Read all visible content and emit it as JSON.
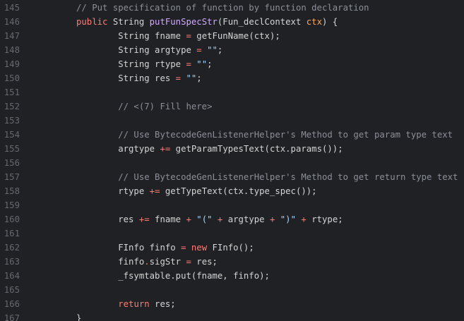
{
  "editor": {
    "lines": [
      {
        "n": "145",
        "tokens": [
          {
            "t": "// Put specification of function by function declaration",
            "c": "comment"
          }
        ]
      },
      {
        "n": "146",
        "tokens": [
          {
            "t": "public",
            "c": "kw"
          },
          {
            "t": " String ",
            "c": "plain"
          },
          {
            "t": "putFunSpecStr",
            "c": "fn"
          },
          {
            "t": "(Fun_declContext ",
            "c": "plain"
          },
          {
            "t": "ctx",
            "c": "param"
          },
          {
            "t": ") {",
            "c": "plain"
          }
        ]
      },
      {
        "n": "147",
        "tokens": [
          {
            "t": "        String fname ",
            "c": "plain"
          },
          {
            "t": "=",
            "c": "op"
          },
          {
            "t": " getFunName(ctx);",
            "c": "plain"
          }
        ]
      },
      {
        "n": "148",
        "tokens": [
          {
            "t": "        String argtype ",
            "c": "plain"
          },
          {
            "t": "=",
            "c": "op"
          },
          {
            "t": " ",
            "c": "plain"
          },
          {
            "t": "\"\"",
            "c": "str"
          },
          {
            "t": ";",
            "c": "plain"
          }
        ]
      },
      {
        "n": "149",
        "tokens": [
          {
            "t": "        String rtype ",
            "c": "plain"
          },
          {
            "t": "=",
            "c": "op"
          },
          {
            "t": " ",
            "c": "plain"
          },
          {
            "t": "\"\"",
            "c": "str"
          },
          {
            "t": ";",
            "c": "plain"
          }
        ]
      },
      {
        "n": "150",
        "tokens": [
          {
            "t": "        String res ",
            "c": "plain"
          },
          {
            "t": "=",
            "c": "op"
          },
          {
            "t": " ",
            "c": "plain"
          },
          {
            "t": "\"\"",
            "c": "str"
          },
          {
            "t": ";",
            "c": "plain"
          }
        ]
      },
      {
        "n": "151",
        "tokens": []
      },
      {
        "n": "152",
        "tokens": [
          {
            "t": "        // <(7) Fill here>",
            "c": "comment"
          }
        ]
      },
      {
        "n": "153",
        "tokens": []
      },
      {
        "n": "154",
        "tokens": [
          {
            "t": "        // Use BytecodeGenListenerHelper's Method to get param type text",
            "c": "comment"
          }
        ]
      },
      {
        "n": "155",
        "tokens": [
          {
            "t": "        argtype ",
            "c": "plain"
          },
          {
            "t": "+=",
            "c": "op"
          },
          {
            "t": " getParamTypesText(ctx.params());",
            "c": "plain"
          }
        ]
      },
      {
        "n": "156",
        "tokens": []
      },
      {
        "n": "157",
        "tokens": [
          {
            "t": "        // Use BytecodeGenListenerHelper's Method to get return type text",
            "c": "comment"
          }
        ]
      },
      {
        "n": "158",
        "tokens": [
          {
            "t": "        rtype ",
            "c": "plain"
          },
          {
            "t": "+=",
            "c": "op"
          },
          {
            "t": " getTypeText(ctx.type_spec());",
            "c": "plain"
          }
        ]
      },
      {
        "n": "159",
        "tokens": []
      },
      {
        "n": "160",
        "tokens": [
          {
            "t": "        res ",
            "c": "plain"
          },
          {
            "t": "+=",
            "c": "op"
          },
          {
            "t": " fname ",
            "c": "plain"
          },
          {
            "t": "+",
            "c": "op"
          },
          {
            "t": " ",
            "c": "plain"
          },
          {
            "t": "\"(\"",
            "c": "str"
          },
          {
            "t": " ",
            "c": "plain"
          },
          {
            "t": "+",
            "c": "op"
          },
          {
            "t": " argtype ",
            "c": "plain"
          },
          {
            "t": "+",
            "c": "op"
          },
          {
            "t": " ",
            "c": "plain"
          },
          {
            "t": "\")\"",
            "c": "str"
          },
          {
            "t": " ",
            "c": "plain"
          },
          {
            "t": "+",
            "c": "op"
          },
          {
            "t": " rtype;",
            "c": "plain"
          }
        ]
      },
      {
        "n": "161",
        "tokens": []
      },
      {
        "n": "162",
        "tokens": [
          {
            "t": "        FInfo finfo ",
            "c": "plain"
          },
          {
            "t": "=",
            "c": "op"
          },
          {
            "t": " ",
            "c": "plain"
          },
          {
            "t": "new",
            "c": "kw"
          },
          {
            "t": " FInfo();",
            "c": "plain"
          }
        ]
      },
      {
        "n": "163",
        "tokens": [
          {
            "t": "        finfo",
            "c": "plain"
          },
          {
            "t": ".",
            "c": "op"
          },
          {
            "t": "sigStr ",
            "c": "plain"
          },
          {
            "t": "=",
            "c": "op"
          },
          {
            "t": " res;",
            "c": "plain"
          }
        ]
      },
      {
        "n": "164",
        "tokens": [
          {
            "t": "        _fsymtable.put(fname, finfo);",
            "c": "plain"
          }
        ]
      },
      {
        "n": "165",
        "tokens": []
      },
      {
        "n": "166",
        "tokens": [
          {
            "t": "        ",
            "c": "plain"
          },
          {
            "t": "return",
            "c": "kw"
          },
          {
            "t": " res;",
            "c": "plain"
          }
        ]
      },
      {
        "n": "167",
        "tokens": [
          {
            "t": "}",
            "c": "plain"
          }
        ]
      }
    ]
  }
}
